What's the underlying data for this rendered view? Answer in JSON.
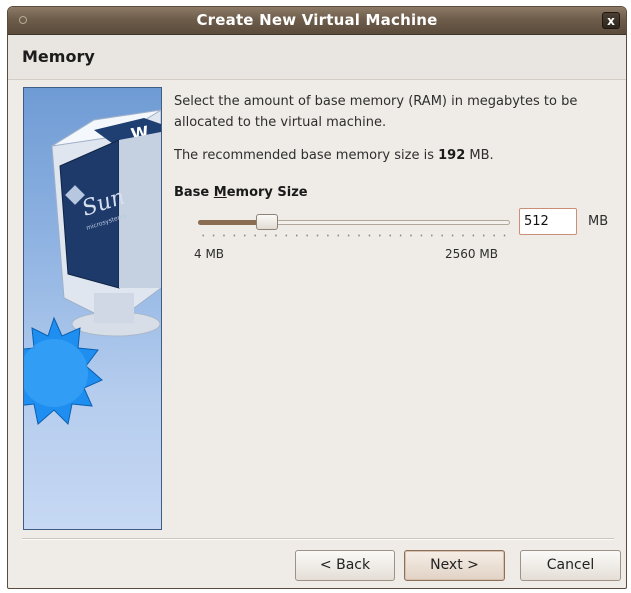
{
  "window": {
    "title": "Create New Virtual Machine",
    "close_glyph": "x"
  },
  "page": {
    "title": "Memory"
  },
  "content": {
    "description": "Select the amount of base memory (RAM) in megabytes to be allocated to the virtual machine.",
    "recommended_prefix": "The recommended base memory size is ",
    "recommended_value": "192",
    "recommended_suffix": " MB."
  },
  "memory": {
    "label_prefix": "Base ",
    "label_mnemonic": "M",
    "label_suffix": "emory Size",
    "value": "512",
    "unit": "MB",
    "min_label": "4 MB",
    "max_label": "2560 MB",
    "slider_fraction": 0.22
  },
  "buttons": {
    "back": "< Back",
    "next": "Next >",
    "cancel": "Cancel"
  },
  "image": {
    "logo_text": "Sun",
    "logo_subtext": "microsystems"
  },
  "colors": {
    "titlebar": "#6e5d4b",
    "slider_fill": "#8a6c53",
    "input_border": "#c98f79"
  }
}
